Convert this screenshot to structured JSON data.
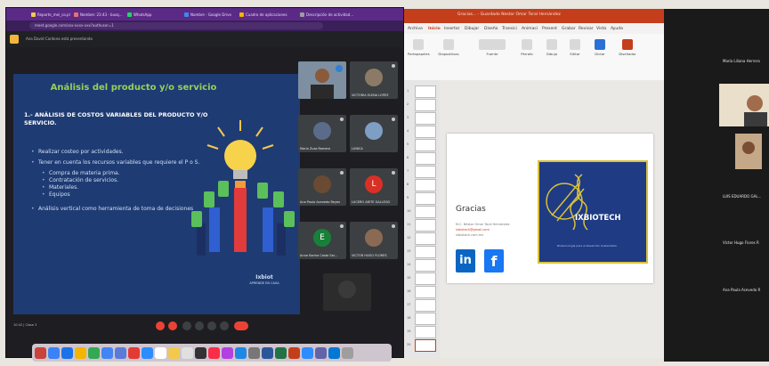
{
  "browser": {
    "tabs": [
      "Reporte_mei_co.pl",
      "Nombre: 23:43 - busq...",
      "WhatsApp",
      "Nombre - Google Drive",
      "Cuadro de aplicaciones",
      "Descripción de actividad..."
    ],
    "address": "meet.google.com/xxx-xxxx-xxx?authuser=1"
  },
  "meet": {
    "presenting_label": "Ana David Cardona está presentando",
    "participants": [
      "",
      "VICTORIA ELENA LOPEZ",
      "Maria Zuaz Romero",
      "LUNICA",
      "Ana Paula Acevedo Reyes",
      "LUCERO ARITE GALLEGO",
      "Anne Karina Costa Sal...",
      "VICTOR HUGO FLORES",
      ""
    ],
    "controls_label": "10:42 | Clase 3"
  },
  "slide": {
    "title": "Análisis del producto y/o servicio",
    "heading": "1.- ANÁLISIS DE COSTOS VARIABLES DEL PRODUCTO Y/O SERVICIO.",
    "bullets": [
      "Realizar costeo por actividades.",
      "Tener en cuenta los recursos variables que requiere el P o S.",
      "Análisis vertical como herramienta de toma de decisiones"
    ],
    "sub_bullets": [
      "Compra de materia prima.",
      "Contratación de servicios.",
      "Materiales.",
      "Equipos"
    ],
    "logo": "Ixbiot",
    "logo_sub": "APRENDE EN CASA"
  },
  "powerpoint": {
    "title": "Gracias... - Guardado     Nestor Omar Toral Hernández",
    "tabs": [
      "Archivo",
      "Inicio",
      "Insertar",
      "Dibujar",
      "Diseño",
      "Transici",
      "Animaci",
      "Present",
      "Grabar",
      "Revisar",
      "Vista",
      "Ayuda"
    ],
    "ribbon": [
      "Portapapeles",
      "Diapositivas",
      "Fuente",
      "Párrafo",
      "Dibujo",
      "Editar",
      "Dictar",
      "Diseñador"
    ],
    "slide_numbers": [
      "1",
      "2",
      "3",
      "4",
      "5",
      "6",
      "7",
      "8",
      "9",
      "10",
      "11",
      "12",
      "13",
      "14",
      "15",
      "16",
      "17",
      "18",
      "19",
      "20"
    ],
    "slide": {
      "gracias": "Gracias",
      "name": "M.C. Néstor Omar Toral Hernández",
      "email": "ixbiotech@gmail.com",
      "web": "ixbiotech.com.mx",
      "linkedin": "in",
      "facebook": "f",
      "logo_text": "IXBIOTECH",
      "logo_sub": "Biotecnología para el Desarrollo Sustentable"
    }
  },
  "zoom": {
    "names": [
      "María Liliana Herrera",
      "LUIS EDUARDO GAL...",
      "Víctor Hugo Flores R",
      "Ana Paula Acevedo R"
    ]
  }
}
